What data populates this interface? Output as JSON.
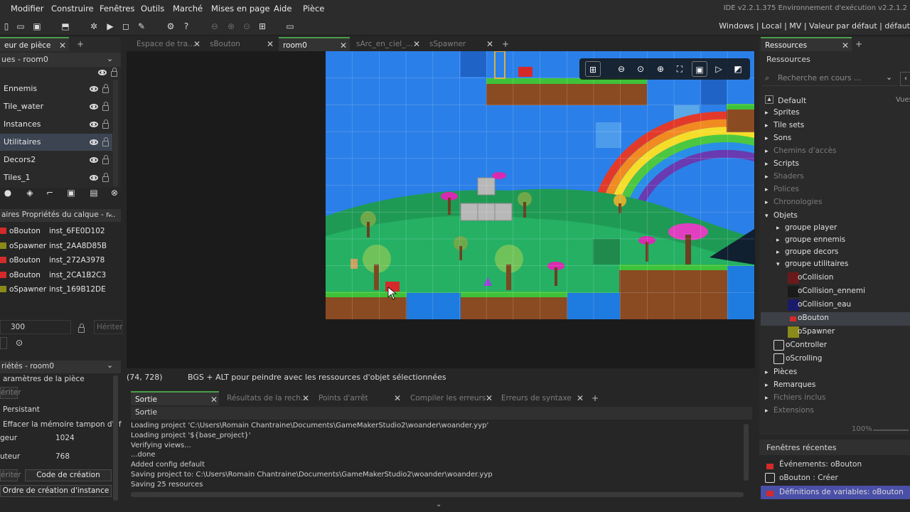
{
  "menu": {
    "items": [
      "Modifier",
      "Construire",
      "Fenêtres",
      "Outils",
      "Marché",
      "Mises en page",
      "Aide",
      "Pièce"
    ],
    "ide_version": "IDE v2.2.1.375 Environnement d'exécution v2.2.1.2"
  },
  "targets": {
    "text": "Windows  |  Local  |  MV  |  Valeur par défaut  |  défaut"
  },
  "layers_panel": {
    "tab": "eur de pièce",
    "header": "ues - room0",
    "layers": [
      "Ennemis",
      "Tile_water",
      "Instances",
      "Utilitaires",
      "Decors2",
      "Tiles_1"
    ]
  },
  "instances_panel": {
    "header": "aires Propriétés du calque - r...",
    "instances": [
      {
        "obj": "oBouton",
        "id": "inst_6FE0D102",
        "color": "#d42a2a"
      },
      {
        "obj": "oSpawner",
        "id": "inst_2AA8D85B",
        "color": "#8a8a1a"
      },
      {
        "obj": "oBouton",
        "id": "inst_272A3978",
        "color": "#d42a2a"
      },
      {
        "obj": "oBouton",
        "id": "inst_2CA1B2C3",
        "color": "#d42a2a"
      },
      {
        "obj": "oSpawner",
        "id": "inst_169B12DE",
        "color": "#8a8a1a"
      }
    ],
    "depth": "300",
    "inherit_placeholder": "Hériter"
  },
  "props_panel": {
    "header": "riétés - room0",
    "section": "aramètres de la pièce",
    "inherit": "ériter",
    "persistent": "Persistant",
    "clear": "Effacer la mémoire tampon d'af",
    "width_label": "geur",
    "width": "1024",
    "height_label": "uteur",
    "height": "768",
    "inherit2": "ériter",
    "creation_code": "Code de création",
    "instance_order": "Ordre de création d'instance"
  },
  "editor_tabs": [
    {
      "label": "Espace de tra...",
      "active": false
    },
    {
      "label": "sBouton",
      "active": false
    },
    {
      "label": "room0",
      "active": true
    },
    {
      "label": "sArc_en_ciel_...",
      "active": false
    },
    {
      "label": "sSpawner",
      "active": false
    }
  ],
  "status": {
    "coords": "(74, 728)",
    "hint": "BGS + ALT pour peindre avec les ressources d'objet sélectionnées"
  },
  "output_tabs": [
    "Sortie",
    "Résultats de la rech...",
    "Points d'arrêt",
    "Compiler les erreurs",
    "Erreurs de syntaxe"
  ],
  "output": {
    "title": "Sortie",
    "lines": [
      "Loading project 'C:\\Users\\Romain Chantraine\\Documents\\GameMakerStudio2\\woander\\woander.yyp'",
      "Loading project '${base_project}'",
      "Verifying views...",
      "...done",
      "Added config default",
      "Saving project to: C:\\Users\\Romain Chantraine\\Documents\\GameMakerStudio2\\woander\\woander.yyp",
      "Saving 25 resources"
    ]
  },
  "resources": {
    "tab": "Ressources",
    "title": "Ressources",
    "search_placeholder": "Recherche en cours ...",
    "group": "Default",
    "views": "Vues",
    "zoom": "100%",
    "tree": [
      {
        "label": "Sprites",
        "dim": false
      },
      {
        "label": "Tile sets",
        "dim": false
      },
      {
        "label": "Sons",
        "dim": false
      },
      {
        "label": "Chemins d'accès",
        "dim": true
      },
      {
        "label": "Scripts",
        "dim": false
      },
      {
        "label": "Shaders",
        "dim": true
      },
      {
        "label": "Polices",
        "dim": true
      },
      {
        "label": "Chronologies",
        "dim": true
      },
      {
        "label": "Objets",
        "dim": false
      },
      {
        "label": "groupe player",
        "dim": false
      },
      {
        "label": "groupe ennemis",
        "dim": false
      },
      {
        "label": "groupe decors",
        "dim": false
      },
      {
        "label": "groupe utilitaires",
        "dim": false
      },
      {
        "label": "oCollision",
        "dim": false
      },
      {
        "label": "oCollision_ennemi",
        "dim": false
      },
      {
        "label": "oCollision_eau",
        "dim": false
      },
      {
        "label": "oBouton",
        "dim": false
      },
      {
        "label": "oSpawner",
        "dim": false
      },
      {
        "label": "oController",
        "dim": false
      },
      {
        "label": "oScrolling",
        "dim": false
      },
      {
        "label": "Pièces",
        "dim": false
      },
      {
        "label": "Remarques",
        "dim": false
      },
      {
        "label": "Fichiers inclus",
        "dim": true
      },
      {
        "label": "Extensions",
        "dim": true
      }
    ]
  },
  "recent": {
    "title": "Fenêtres récentes",
    "items": [
      "Événements: oBouton",
      "oBouton : Créer",
      "Définitions de variables: oBouton"
    ]
  }
}
